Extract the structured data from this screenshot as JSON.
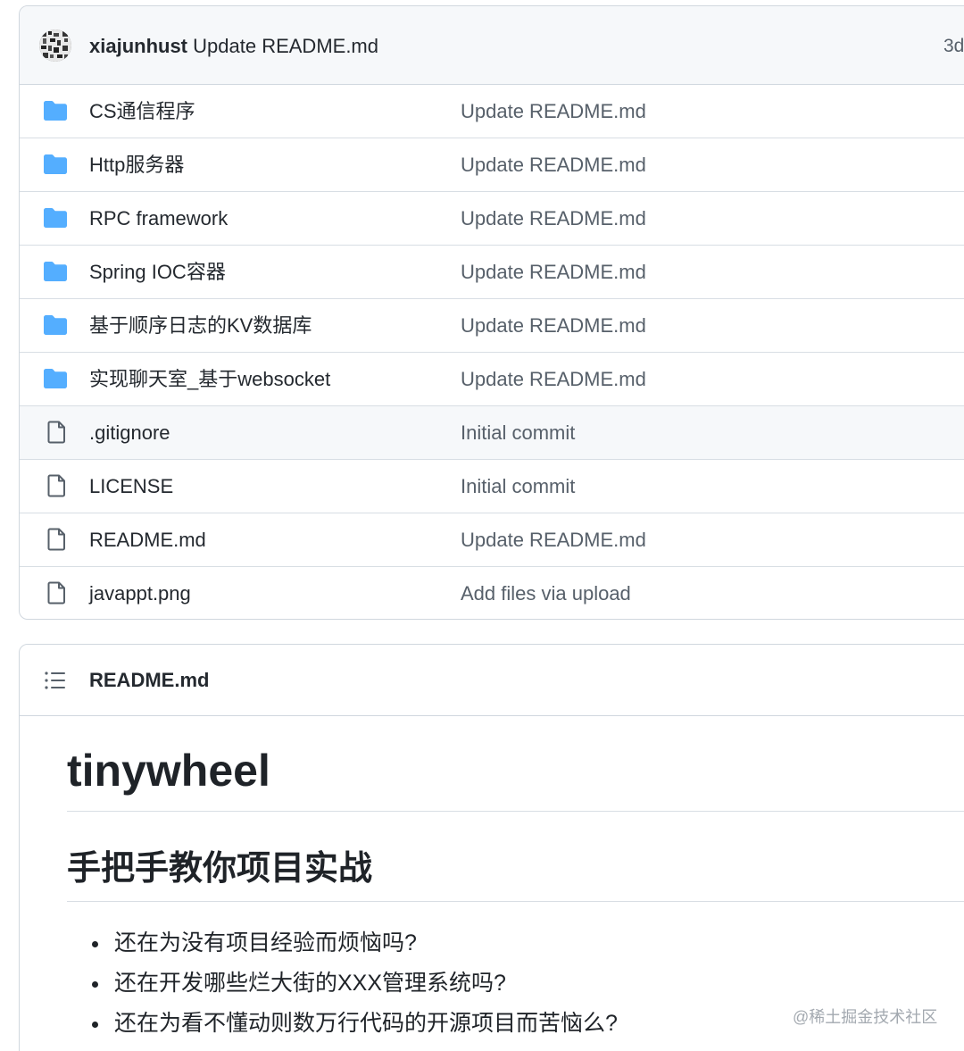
{
  "commit": {
    "author": "xiajunhust",
    "message": "Update README.md",
    "age": "3d"
  },
  "files": [
    {
      "name": "CS通信程序",
      "commit": "Update README.md",
      "type": "folder"
    },
    {
      "name": "Http服务器",
      "commit": "Update README.md",
      "type": "folder"
    },
    {
      "name": "RPC framework",
      "commit": "Update README.md",
      "type": "folder"
    },
    {
      "name": "Spring IOC容器",
      "commit": "Update README.md",
      "type": "folder"
    },
    {
      "name": "基于顺序日志的KV数据库",
      "commit": "Update README.md",
      "type": "folder"
    },
    {
      "name": "实现聊天室_基于websocket",
      "commit": "Update README.md",
      "type": "folder"
    },
    {
      "name": ".gitignore",
      "commit": "Initial commit",
      "type": "file"
    },
    {
      "name": "LICENSE",
      "commit": "Initial commit",
      "type": "file"
    },
    {
      "name": "README.md",
      "commit": "Update README.md",
      "type": "file"
    },
    {
      "name": "javappt.png",
      "commit": "Add files via upload",
      "type": "file"
    }
  ],
  "readme": {
    "filename": "README.md",
    "h1": "tinywheel",
    "h2": "手把手教你项目实战",
    "bullets": [
      "还在为没有项目经验而烦恼吗?",
      "还在开发哪些烂大街的XXX管理系统吗?",
      "还在为看不懂动则数万行代码的开源项目而苦恼么?"
    ]
  },
  "watermark": "@稀土掘金技术社区",
  "colors": {
    "folder": "#54aeff",
    "file_icon": "#57606a",
    "border": "#d0d7de",
    "header_bg": "#f6f8fa",
    "muted_text": "#57606a"
  },
  "icons": {
    "folder": "folder-icon",
    "file": "file-icon",
    "list": "list-unordered-icon"
  }
}
